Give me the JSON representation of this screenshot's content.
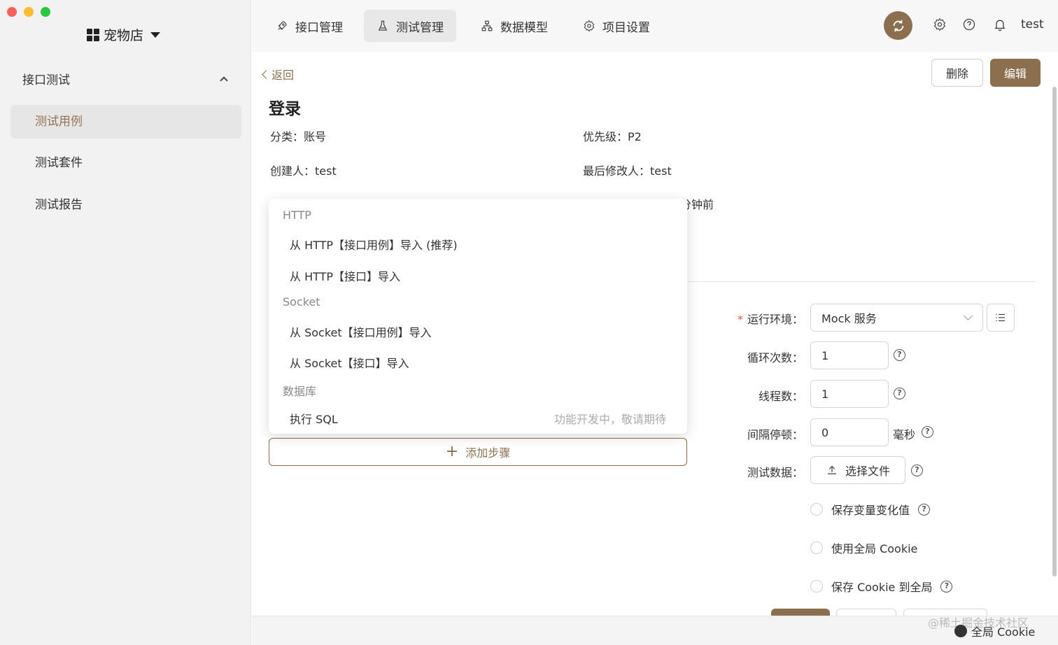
{
  "app": {
    "store_name": "宠物店"
  },
  "sidebar": {
    "group_label": "接口测试",
    "items": [
      {
        "label": "测试用例",
        "active": true
      },
      {
        "label": "测试套件",
        "active": false
      },
      {
        "label": "测试报告",
        "active": false
      }
    ]
  },
  "header": {
    "tabs": [
      {
        "label": "接口管理",
        "icon": "rocket-icon",
        "active": false
      },
      {
        "label": "测试管理",
        "icon": "flask-icon",
        "active": true
      },
      {
        "label": "数据模型",
        "icon": "hierarchy-icon",
        "active": false
      },
      {
        "label": "项目设置",
        "icon": "gear-icon",
        "active": false
      }
    ],
    "user": "test"
  },
  "detail": {
    "back_label": "返回",
    "delete_label": "删除",
    "edit_label": "编辑",
    "title": "登录",
    "category_key": "分类：",
    "category_value": "账号",
    "priority_key": "优先级：",
    "priority_value": "P2",
    "creator_key": "创建人：",
    "creator_value": "test",
    "modifier_key": "最后修改人：",
    "modifier_value": "test",
    "modified_tail": "分钟前"
  },
  "dropdown": {
    "groups": [
      {
        "label": "HTTP",
        "items": [
          "从 HTTP【接口用例】导入 (推荐)",
          "从 HTTP【接口】导入"
        ]
      },
      {
        "label": "Socket",
        "items": [
          "从 Socket【接口用例】导入",
          "从 Socket【接口】导入"
        ]
      },
      {
        "label": "数据库",
        "items": [
          "执行 SQL"
        ]
      }
    ],
    "sql_note": "功能开发中，敬请期待"
  },
  "add_step_label": "添加步骤",
  "form": {
    "env_label": "运行环境：",
    "env_value": "Mock 服务",
    "loop_label": "循环次数：",
    "loop_value": "1",
    "thread_label": "线程数：",
    "thread_value": "1",
    "interval_label": "间隔停顿：",
    "interval_value": "0",
    "interval_unit": "毫秒",
    "testdata_label": "测试数据：",
    "file_button": "选择文件",
    "save_var_label": "保存变量变化值",
    "global_cookie_label": "使用全局 Cookie",
    "save_cookie_label": "保存 Cookie 到全局"
  },
  "watermark": "@稀土掘金技术社区",
  "cookie_tag": "全局 Cookie",
  "colors": {
    "accent": "#8b6f4e",
    "required": "#e05a4f"
  }
}
